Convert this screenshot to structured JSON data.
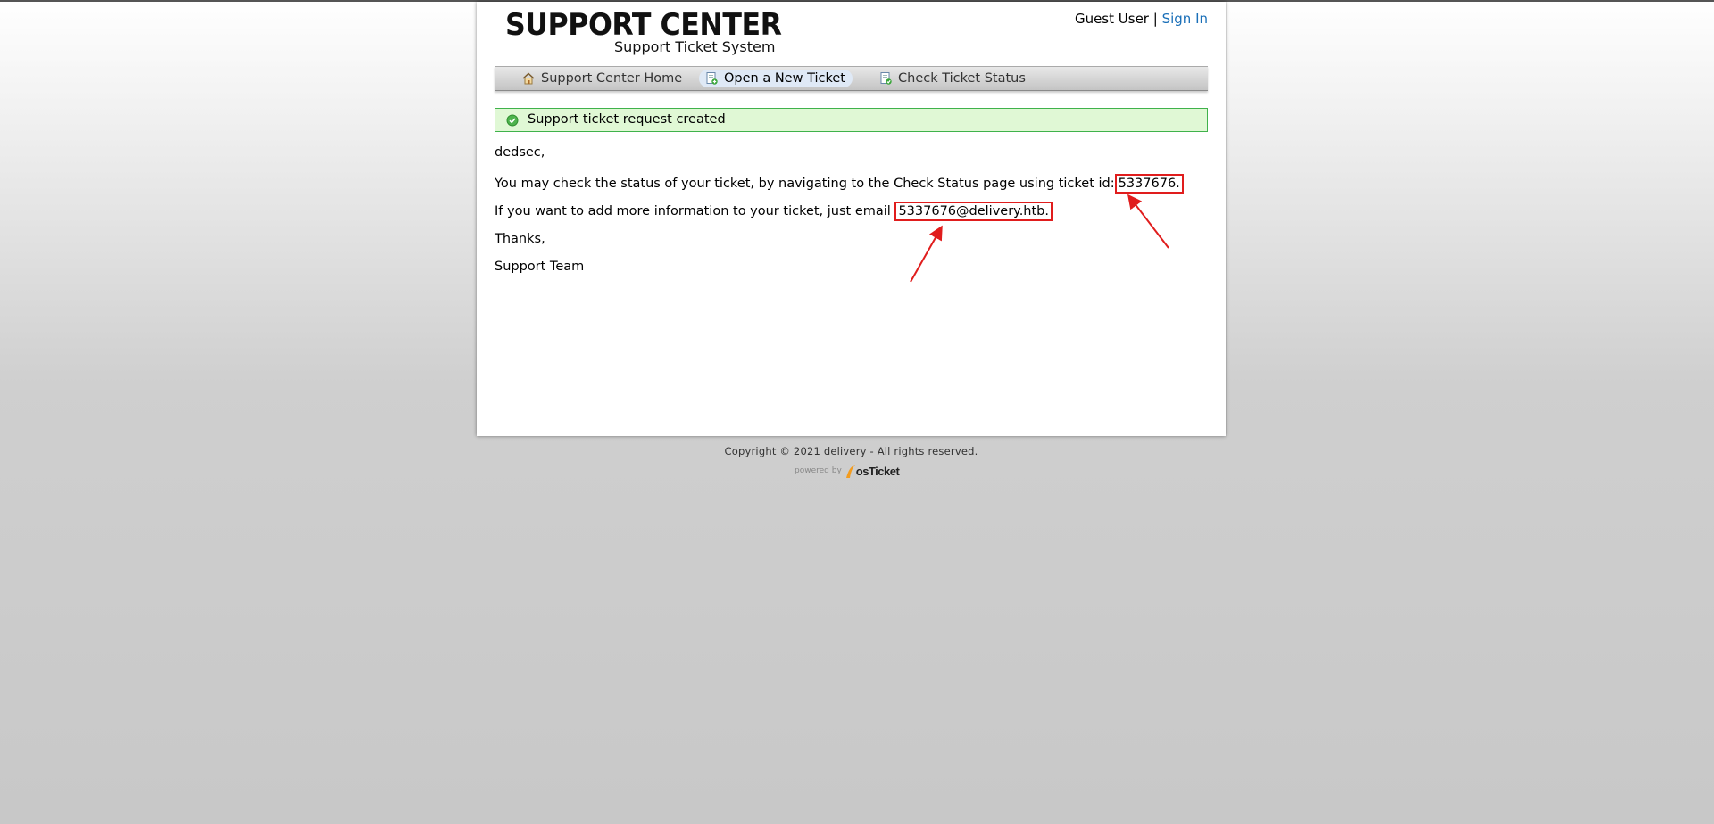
{
  "header": {
    "logo_title": "SUPPORT CENTER",
    "logo_subtitle": "Support Ticket System",
    "guest_text": "Guest User |",
    "sign_in": "Sign In"
  },
  "nav": {
    "items": [
      {
        "label": "Support Center Home",
        "icon": "home-icon"
      },
      {
        "label": "Open a New Ticket",
        "icon": "new-ticket-icon",
        "active": true
      },
      {
        "label": "Check Ticket Status",
        "icon": "ticket-status-icon"
      }
    ]
  },
  "notice": {
    "text": "Support ticket request created",
    "icon": "check-circle-icon"
  },
  "message": {
    "greeting": "dedsec,",
    "status_text": "You may check the status of your ticket, by navigating to the Check Status page using ticket id:",
    "ticket_id": "5337676.",
    "email_text": "If you want to add more information to your ticket, just email",
    "email": "5337676@delivery.htb.",
    "thanks": "Thanks,",
    "signature": "Support Team"
  },
  "footer": {
    "copyright": "Copyright © 2021 delivery - All rights reserved.",
    "powered_by": "powered by",
    "brand": "osTicket"
  },
  "colors": {
    "link": "#1a6fb8",
    "notice_bg": "#e0f8d5",
    "notice_border": "#3fb24b",
    "annotation": "#e01d1d"
  }
}
